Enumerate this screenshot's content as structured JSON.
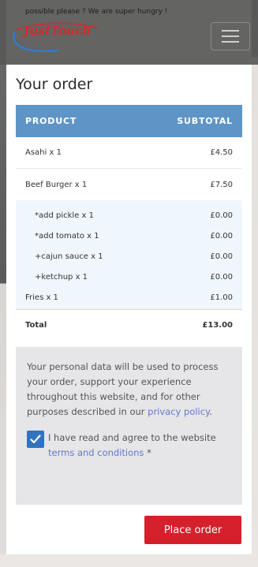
{
  "header": {
    "note": "possible please ? We are super hungry !",
    "logo_text": "JustTouch",
    "brand_color": "#d42a2a"
  },
  "order": {
    "title": "Your order",
    "columns": {
      "product": "PRODUCT",
      "subtotal": "SUBTOTAL"
    },
    "items": [
      {
        "name": "Asahi x 1",
        "price": "£4.50"
      },
      {
        "name": "Beef Burger x 1",
        "price": "£7.50"
      }
    ],
    "addons": [
      {
        "name": "*add pickle x 1",
        "price": "£0.00"
      },
      {
        "name": "*add tomato x 1",
        "price": "£0.00"
      },
      {
        "name": "+cajun sauce x 1",
        "price": "£0.00"
      },
      {
        "name": "+ketchup x 1",
        "price": "£0.00"
      },
      {
        "name": "Fries x 1",
        "price": "£1.00"
      }
    ],
    "total_label": "Total",
    "total_value": "£13.00",
    "header_color": "#5e95c6"
  },
  "privacy": {
    "text": "Your personal data will be used to process your order, support your experience throughout this website, and for other purposes described in our ",
    "link": "privacy policy",
    "end": "."
  },
  "agree": {
    "checked": true,
    "text": "I have read and agree to the website ",
    "link": "terms and conditions",
    "suffix": " *"
  },
  "place_order": {
    "label": "Place order",
    "color": "#d5202b"
  },
  "icons": {
    "menu": "hamburger-icon",
    "check": "checkmark-icon"
  }
}
